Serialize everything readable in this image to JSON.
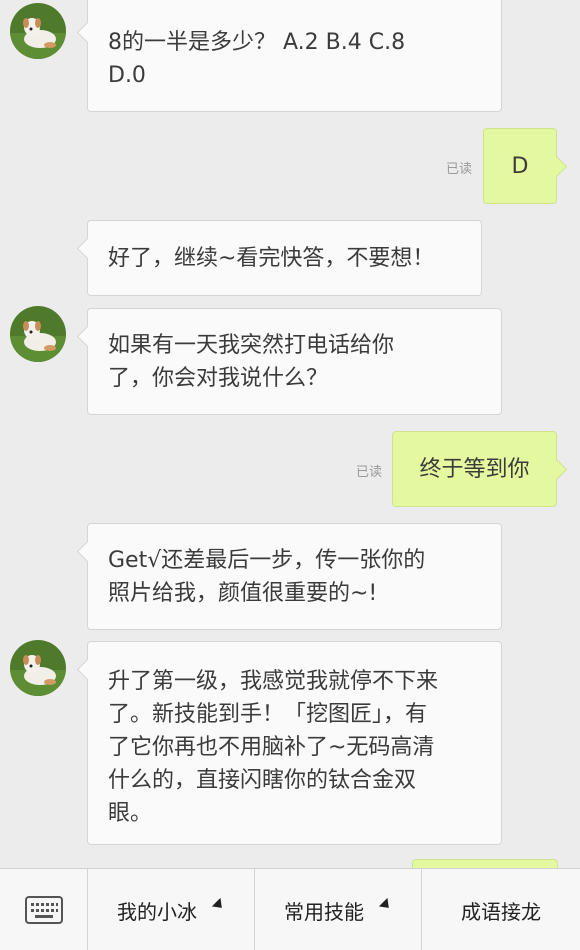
{
  "messages": [
    {
      "id": "m1",
      "direction": "in",
      "lines": [
        "8的一半是多少？  A.2  B.4  C.8",
        "D.0"
      ]
    },
    {
      "id": "m2",
      "direction": "out",
      "text": "D",
      "read_label": "已读"
    },
    {
      "id": "m3",
      "direction": "in",
      "lines": [
        "好了，继续~看完快答，不要想！"
      ]
    },
    {
      "id": "m4",
      "direction": "in",
      "lines": [
        "如果有一天我突然打电话给你",
        "了，你会对我说什么？"
      ]
    },
    {
      "id": "m5",
      "direction": "out",
      "text": "终于等到你",
      "read_label": "已读"
    },
    {
      "id": "m6",
      "direction": "in",
      "lines": [
        "Get√还差最后一步，传一张你的",
        "照片给我，颜值很重要的~!"
      ]
    },
    {
      "id": "m7",
      "direction": "in",
      "lines": [
        "升了第一级，我感觉我就停不下来",
        "了。新技能到手！「挖图匠」，有",
        "了它你再也不用脑补了~无码高清",
        "什么的，直接闪瞎你的钛合金双",
        "眼。"
      ]
    }
  ],
  "toolbar": {
    "keyboard_icon": "keyboard-icon",
    "items": [
      "我的小冰",
      "常用技能",
      "成语接龙"
    ]
  },
  "colors": {
    "background": "#ececec",
    "incoming_bubble": "#fafafa",
    "outgoing_bubble": "#e4f8a0"
  }
}
